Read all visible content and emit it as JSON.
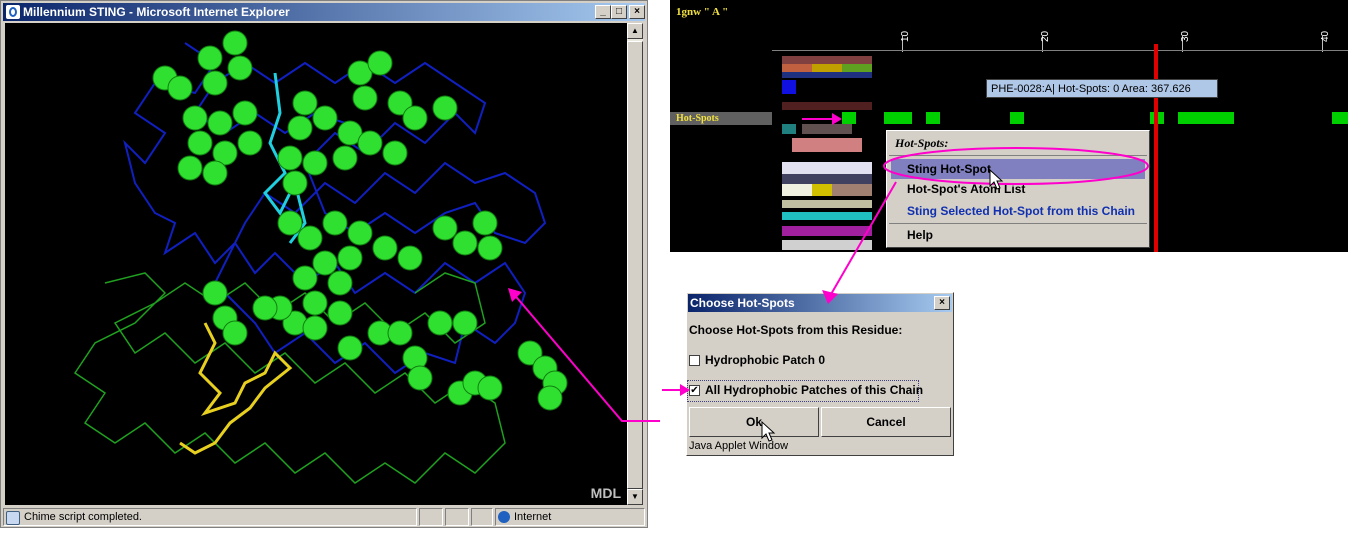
{
  "ie_window": {
    "title": "Millennium STING - Microsoft Internet Explorer",
    "viewer_logo": "MDL",
    "status_text": "Chime script completed.",
    "zone_label": "Internet"
  },
  "sting_panel": {
    "chain_label": "1gnw \" A \"",
    "ruler_ticks": [
      "10",
      "20",
      "30",
      "40"
    ],
    "track_label": "Hot-Spots",
    "tooltip": "PHE-0028:A| Hot-Spots: 0  Area: 367.626",
    "menu": {
      "header": "Hot-Spots:",
      "items": [
        "Sting Hot-Spot",
        "Hot-Spot's Atom List",
        "Sting Selected Hot-Spot from this Chain",
        "Help"
      ]
    }
  },
  "dialog": {
    "title": "Choose Hot-Spots",
    "prompt": "Choose Hot-Spots from this Residue:",
    "option1": "Hydrophobic Patch 0",
    "option2": "All Hydrophobic Patches of this Chain",
    "ok_label": "Ok",
    "cancel_label": "Cancel",
    "footer": "Java Applet Window"
  },
  "colors": {
    "annotation": "#ff00cc",
    "hotspot": "#00d000",
    "marker": "#e00000",
    "title_bar": "#0a246a"
  }
}
